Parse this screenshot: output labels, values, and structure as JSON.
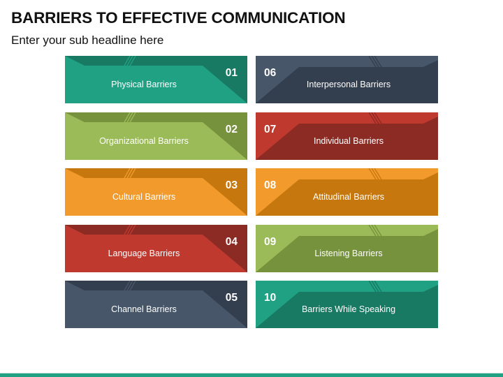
{
  "slide": {
    "title": "BARRIERS TO EFFECTIVE COMMUNICATION",
    "subtitle": "Enter your sub headline here"
  },
  "cards": [
    {
      "num": "01",
      "label": "Physical Barriers",
      "side": "left",
      "light": "#21a184",
      "dark": "#187a62"
    },
    {
      "num": "02",
      "label": "Organizational Barriers",
      "side": "left",
      "light": "#9bbb59",
      "dark": "#76923c"
    },
    {
      "num": "03",
      "label": "Cultural Barriers",
      "side": "left",
      "light": "#f29b2c",
      "dark": "#c6780f"
    },
    {
      "num": "04",
      "label": "Language Barriers",
      "side": "left",
      "light": "#c0392f",
      "dark": "#8c2a24"
    },
    {
      "num": "05",
      "label": "Channel Barriers",
      "side": "left",
      "light": "#475669",
      "dark": "#333e4e"
    },
    {
      "num": "06",
      "label": "Interpersonal Barriers",
      "side": "right",
      "light": "#475669",
      "dark": "#333e4e"
    },
    {
      "num": "07",
      "label": "Individual Barriers",
      "side": "right",
      "light": "#c0392f",
      "dark": "#8c2a24"
    },
    {
      "num": "08",
      "label": "Attitudinal Barriers",
      "side": "right",
      "light": "#f29b2c",
      "dark": "#c6780f"
    },
    {
      "num": "09",
      "label": "Listening Barriers",
      "side": "right",
      "light": "#9bbb59",
      "dark": "#76923c"
    },
    {
      "num": "10",
      "label": "Barriers While Speaking",
      "side": "right",
      "light": "#21a184",
      "dark": "#187a62"
    }
  ],
  "footer": {
    "accent": "#21a184"
  }
}
